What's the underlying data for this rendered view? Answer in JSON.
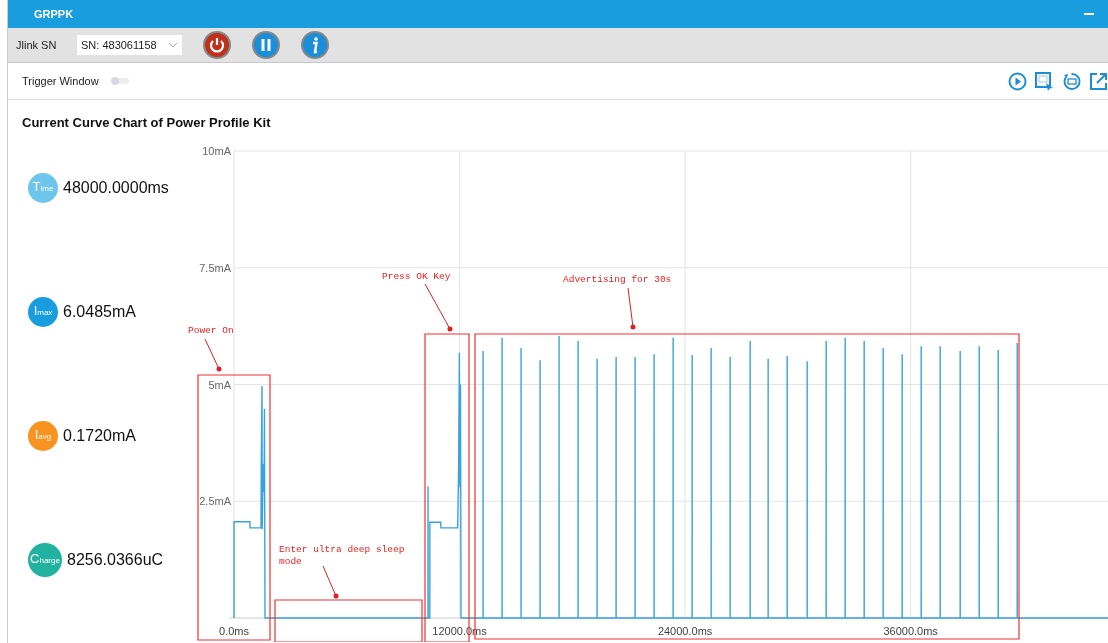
{
  "window": {
    "title": "GRPPK"
  },
  "toolbar": {
    "jlink_label": "Jlink SN",
    "sn_value": "SN: 483061158"
  },
  "trigger": {
    "label": "Trigger Window",
    "on": false
  },
  "stats": [
    {
      "kind": "time",
      "letter": "T",
      "sub": "ime",
      "value": "48000.0000ms",
      "color": "#6ec6ec"
    },
    {
      "kind": "imax",
      "letter": "I",
      "sub": "max",
      "value": "6.0485mA",
      "color": "#1a9ddf"
    },
    {
      "kind": "iavg",
      "letter": "I",
      "sub": "avg",
      "value": "0.1720mA",
      "color": "#f7931e"
    },
    {
      "kind": "charge",
      "letter": "C",
      "sub": "harge",
      "value": "8256.0366uC",
      "color": "#22b3a0"
    }
  ],
  "chart_data": {
    "type": "line",
    "grid": true,
    "title": "Current Curve Chart of Power Profile Kit",
    "xlim": [
      0,
      46500
    ],
    "ylim": [
      0,
      10
    ],
    "yticks": [
      {
        "value": 10,
        "label": "10mA"
      },
      {
        "value": 7.5,
        "label": "7.5mA"
      },
      {
        "value": 5,
        "label": "5mA"
      },
      {
        "value": 2.5,
        "label": "2.5mA"
      }
    ],
    "xticks": [
      {
        "value": 0,
        "label": "0.0ms"
      },
      {
        "value": 12000,
        "label": "12000.0ms"
      },
      {
        "value": 24000,
        "label": "24000.0ms"
      },
      {
        "value": 36000,
        "label": "36000.0ms"
      }
    ],
    "x": [
      0,
      0,
      850,
      851,
      1436,
      1450,
      1490,
      1500,
      1560,
      1600,
      1620,
      1650,
      10320,
      10321,
      10330,
      10420,
      10421,
      11000,
      11010,
      11900,
      11950,
      11990,
      12020,
      12050,
      12080,
      13251,
      13252,
      13253,
      14262,
      14263,
      14264,
      15273,
      15274,
      15275,
      16284,
      16285,
      16286,
      17295,
      17296,
      17297,
      18306,
      18307,
      18308,
      19317,
      19318,
      19319,
      20328,
      20329,
      20330,
      21339,
      21340,
      21341,
      22350,
      22351,
      22352,
      23363,
      23364,
      23365,
      24374,
      24375,
      24376,
      25385,
      25386,
      25387,
      26396,
      26397,
      26398,
      27460,
      27461,
      27462,
      28418,
      28419,
      28420,
      29430,
      29431,
      29432,
      30494,
      30495,
      30496,
      31505,
      31506,
      31507,
      32516,
      32517,
      32518,
      33527,
      33528,
      33529,
      34538,
      34539,
      34540,
      35549,
      35550,
      35551,
      36560,
      36561,
      36562,
      37571,
      37572,
      37573,
      38635,
      38636,
      38637,
      39647,
      39648,
      39649,
      40658,
      40659,
      40660,
      41669,
      41670,
      41671,
      46500
    ],
    "series": [
      {
        "color": "#3aa3dc",
        "values": [
          0,
          2.06,
          2.06,
          1.93,
          1.93,
          3.2,
          4.97,
          1.9,
          3.3,
          2.7,
          4.48,
          0,
          0,
          2.82,
          0,
          0,
          2.05,
          2.05,
          1.93,
          1.93,
          3.2,
          5.68,
          2.8,
          5.0,
          0,
          0,
          5.72,
          0,
          0,
          6.0,
          0,
          0,
          5.78,
          0,
          0,
          5.52,
          0,
          0,
          6.04,
          0,
          0,
          5.93,
          0,
          0,
          5.55,
          0,
          0,
          5.59,
          0,
          0,
          5.59,
          0,
          0,
          5.65,
          0,
          0,
          6.0,
          0,
          0,
          5.63,
          0,
          0,
          5.78,
          0,
          0,
          5.59,
          0,
          0,
          5.93,
          0,
          0,
          5.55,
          0,
          0,
          5.61,
          0,
          0,
          5.5,
          0,
          0,
          5.93,
          0,
          0,
          6.0,
          0,
          0,
          5.93,
          0,
          0,
          5.78,
          0,
          0,
          5.65,
          0,
          0,
          5.82,
          0,
          0,
          5.82,
          0,
          0,
          5.72,
          0,
          0,
          5.82,
          0,
          0,
          5.74,
          0,
          0,
          5.89,
          0,
          0
        ]
      }
    ]
  },
  "annotations": [
    {
      "kind": "power",
      "lines": [
        "Power On"
      ]
    },
    {
      "kind": "sleep",
      "lines": [
        "Enter ultra deep sleep",
        "mode"
      ]
    },
    {
      "kind": "key",
      "lines": [
        "Press OK Key"
      ]
    },
    {
      "kind": "adv",
      "lines": [
        "Advertising for 30s"
      ]
    }
  ]
}
